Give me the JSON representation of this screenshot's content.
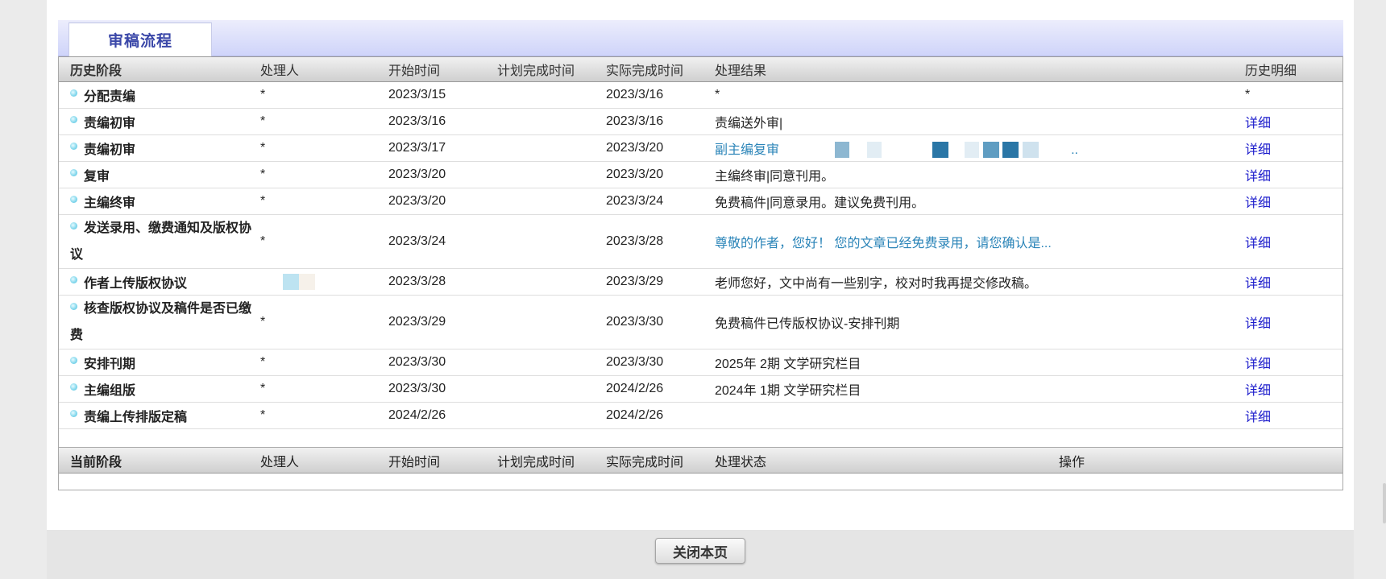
{
  "panel": {
    "tab_label": "审稿流程"
  },
  "history_header": {
    "stage": "历史阶段",
    "handler": "处理人",
    "start": "开始时间",
    "planned": "计划完成时间",
    "actual": "实际完成时间",
    "result": "处理结果",
    "detail": "历史明细"
  },
  "history_rows": [
    {
      "stage": "分配责编",
      "handler": "*",
      "start": "2023/3/15",
      "planned": "",
      "actual": "2023/3/16",
      "result": "*",
      "result_style": "plain",
      "detail": "*",
      "detail_link": false
    },
    {
      "stage": "责编初审",
      "handler": "*",
      "start": "2023/3/16",
      "planned": "",
      "actual": "2023/3/16",
      "result": "责编送外审|",
      "result_style": "plain",
      "detail": "详细",
      "detail_link": true
    },
    {
      "stage": "责编初审",
      "handler": "*",
      "start": "2023/3/17",
      "planned": "",
      "actual": "2023/3/20",
      "result": "副主编复审",
      "result_tail": "..",
      "result_style": "teal",
      "detail": "详细",
      "detail_link": true
    },
    {
      "stage": "复审",
      "handler": "*",
      "start": "2023/3/20",
      "planned": "",
      "actual": "2023/3/20",
      "result": "主编终审|同意刊用。",
      "result_style": "plain",
      "detail": "详细",
      "detail_link": true
    },
    {
      "stage": "主编终审",
      "handler": "*",
      "start": "2023/3/20",
      "planned": "",
      "actual": "2023/3/24",
      "result": "免费稿件|同意录用。建议免费刊用。",
      "result_style": "plain",
      "detail": "详细",
      "detail_link": true
    },
    {
      "stage": "发送录用、缴费通知及版权协议",
      "handler": "*",
      "start": "2023/3/24",
      "planned": "",
      "actual": "2023/3/28",
      "result": "尊敬的作者，您好！ 您的文章已经免费录用，请您确认是...",
      "result_style": "teal",
      "detail": "详细",
      "detail_link": true
    },
    {
      "stage": "作者上传版权协议",
      "handler": "",
      "start": "2023/3/28",
      "planned": "",
      "actual": "2023/3/29",
      "result": "老师您好，文中尚有一些别字，校对时我再提交修改稿。",
      "result_style": "plain",
      "detail": "详细",
      "detail_link": true
    },
    {
      "stage": "核查版权协议及稿件是否已缴费",
      "handler": "*",
      "start": "2023/3/29",
      "planned": "",
      "actual": "2023/3/30",
      "result": "免费稿件已传版权协议-安排刊期",
      "result_style": "plain",
      "detail": "详细",
      "detail_link": true
    },
    {
      "stage": "安排刊期",
      "handler": "*",
      "start": "2023/3/30",
      "planned": "",
      "actual": "2023/3/30",
      "result": "2025年 2期 文学研究栏目",
      "result_style": "plain",
      "detail": "详细",
      "detail_link": true
    },
    {
      "stage": "主编组版",
      "handler": "*",
      "start": "2023/3/30",
      "planned": "",
      "actual": "2024/2/26",
      "result": "2024年 1期 文学研究栏目",
      "result_style": "plain",
      "detail": "详细",
      "detail_link": true
    },
    {
      "stage": "责编上传排版定稿",
      "handler": "*",
      "start": "2024/2/26",
      "planned": "",
      "actual": "2024/2/26",
      "result": "",
      "result_style": "plain",
      "detail": "详细",
      "detail_link": true
    }
  ],
  "current_header": {
    "stage": "当前阶段",
    "handler": "处理人",
    "start": "开始时间",
    "planned": "计划完成时间",
    "actual": "实际完成时间",
    "status": "处理状态",
    "action": "操作"
  },
  "footer": {
    "close_label": "关闭本页"
  },
  "colors": {
    "tab_text": "#3a47a8",
    "link_detail": "#1d1dcc",
    "link_teal": "#2a84b8"
  }
}
